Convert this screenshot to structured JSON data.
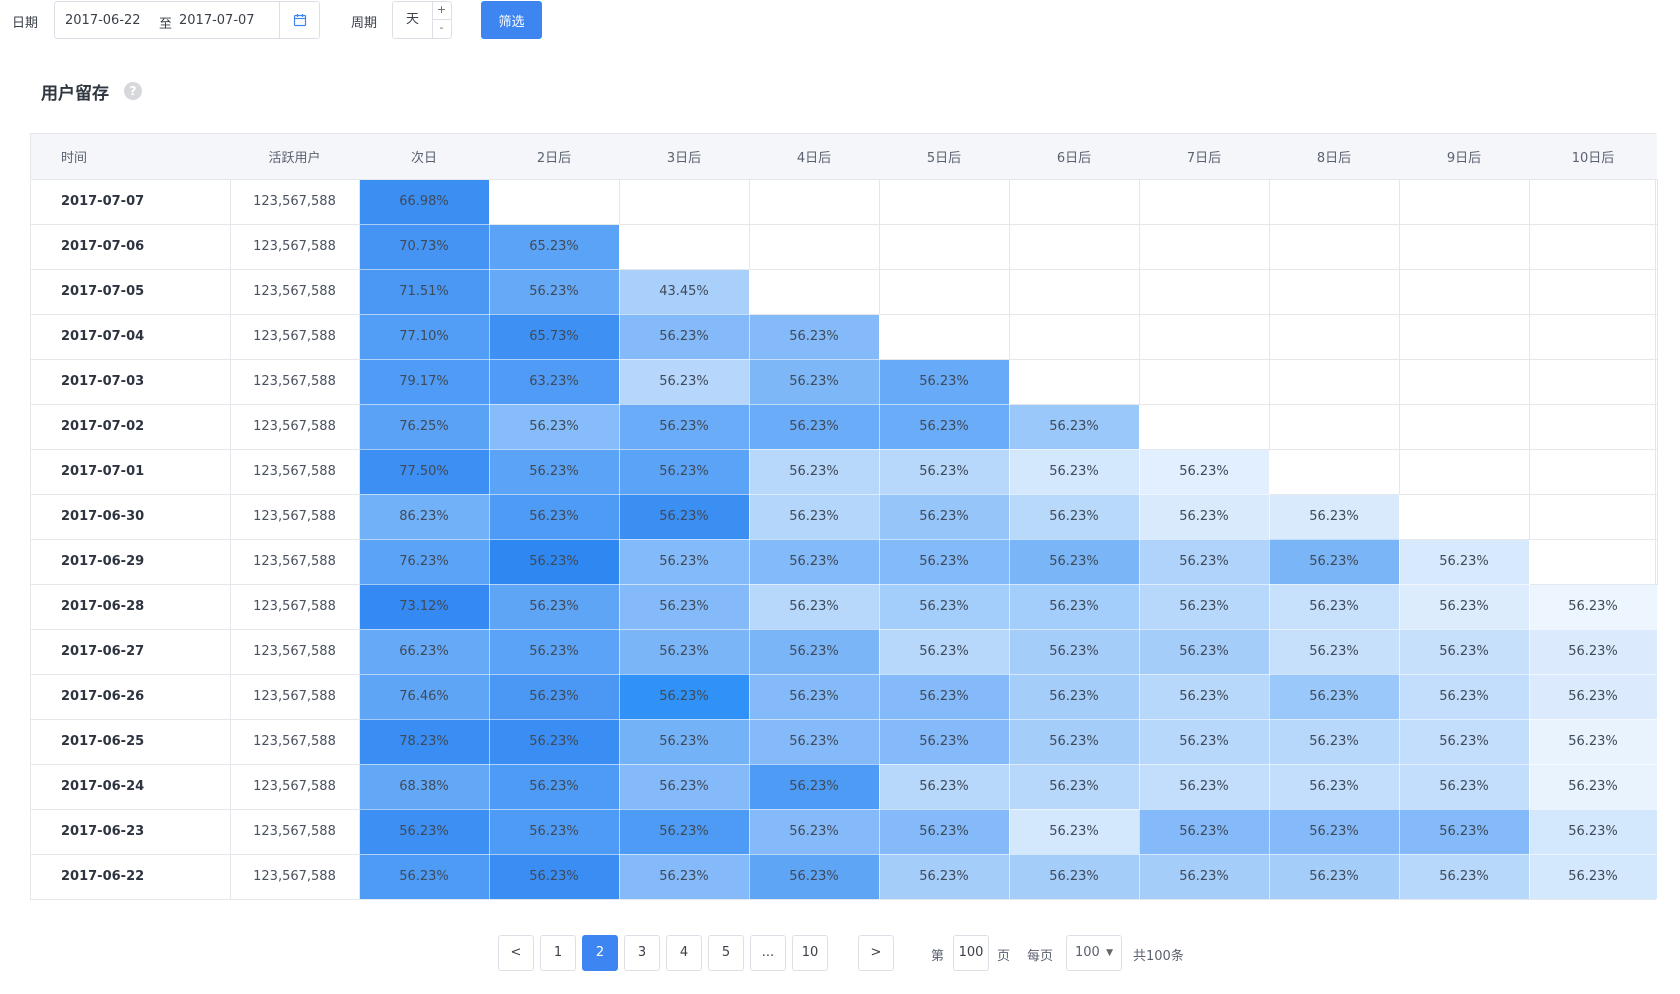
{
  "filter": {
    "date_label": "日期",
    "start_date": "2017-06-22",
    "range_sep": "至",
    "end_date": "2017-07-07",
    "calendar_icon": "calendar-icon",
    "period_label": "周期",
    "period_value": "天",
    "increment": "+",
    "decrement": "-",
    "submit_label": "筛选",
    "accent_color": "#3d85f1"
  },
  "section": {
    "title": "用户留存",
    "help_glyph": "?"
  },
  "table": {
    "headers": [
      "时间",
      "活跃用户",
      "次日",
      "2日后",
      "3日后",
      "4日后",
      "5日后",
      "6日后",
      "7日后",
      "8日后",
      "9日后",
      "10日后"
    ],
    "rows": [
      {
        "date": "2017-07-07",
        "users": "123,567,588",
        "cells": [
          "66.98%"
        ]
      },
      {
        "date": "2017-07-06",
        "users": "123,567,588",
        "cells": [
          "70.73%",
          "65.23%"
        ]
      },
      {
        "date": "2017-07-05",
        "users": "123,567,588",
        "cells": [
          "71.51%",
          "56.23%",
          "43.45%"
        ]
      },
      {
        "date": "2017-07-04",
        "users": "123,567,588",
        "cells": [
          "77.10%",
          "65.73%",
          "56.23%",
          "56.23%"
        ]
      },
      {
        "date": "2017-07-03",
        "users": "123,567,588",
        "cells": [
          "79.17%",
          "63.23%",
          "56.23%",
          "56.23%",
          "56.23%"
        ]
      },
      {
        "date": "2017-07-02",
        "users": "123,567,588",
        "cells": [
          "76.25%",
          "56.23%",
          "56.23%",
          "56.23%",
          "56.23%",
          "56.23%"
        ]
      },
      {
        "date": "2017-07-01",
        "users": "123,567,588",
        "cells": [
          "77.50%",
          "56.23%",
          "56.23%",
          "56.23%",
          "56.23%",
          "56.23%",
          "56.23%"
        ]
      },
      {
        "date": "2017-06-30",
        "users": "123,567,588",
        "cells": [
          "86.23%",
          "56.23%",
          "56.23%",
          "56.23%",
          "56.23%",
          "56.23%",
          "56.23%",
          "56.23%"
        ]
      },
      {
        "date": "2017-06-29",
        "users": "123,567,588",
        "cells": [
          "76.23%",
          "56.23%",
          "56.23%",
          "56.23%",
          "56.23%",
          "56.23%",
          "56.23%",
          "56.23%",
          "56.23%"
        ]
      },
      {
        "date": "2017-06-28",
        "users": "123,567,588",
        "cells": [
          "73.12%",
          "56.23%",
          "56.23%",
          "56.23%",
          "56.23%",
          "56.23%",
          "56.23%",
          "56.23%",
          "56.23%",
          "56.23%"
        ]
      },
      {
        "date": "2017-06-27",
        "users": "123,567,588",
        "cells": [
          "66.23%",
          "56.23%",
          "56.23%",
          "56.23%",
          "56.23%",
          "56.23%",
          "56.23%",
          "56.23%",
          "56.23%",
          "56.23%"
        ]
      },
      {
        "date": "2017-06-26",
        "users": "123,567,588",
        "cells": [
          "76.46%",
          "56.23%",
          "56.23%",
          "56.23%",
          "56.23%",
          "56.23%",
          "56.23%",
          "56.23%",
          "56.23%",
          "56.23%"
        ]
      },
      {
        "date": "2017-06-25",
        "users": "123,567,588",
        "cells": [
          "78.23%",
          "56.23%",
          "56.23%",
          "56.23%",
          "56.23%",
          "56.23%",
          "56.23%",
          "56.23%",
          "56.23%",
          "56.23%"
        ]
      },
      {
        "date": "2017-06-24",
        "users": "123,567,588",
        "cells": [
          "68.38%",
          "56.23%",
          "56.23%",
          "56.23%",
          "56.23%",
          "56.23%",
          "56.23%",
          "56.23%",
          "56.23%",
          "56.23%"
        ]
      },
      {
        "date": "2017-06-23",
        "users": "123,567,588",
        "cells": [
          "56.23%",
          "56.23%",
          "56.23%",
          "56.23%",
          "56.23%",
          "56.23%",
          "56.23%",
          "56.23%",
          "56.23%",
          "56.23%"
        ]
      },
      {
        "date": "2017-06-22",
        "users": "123,567,588",
        "cells": [
          "56.23%",
          "56.23%",
          "56.23%",
          "56.23%",
          "56.23%",
          "56.23%",
          "56.23%",
          "56.23%",
          "56.23%",
          "56.23%"
        ]
      }
    ],
    "heat_colors": [
      [
        "#3b8ef2"
      ],
      [
        "#4594f3",
        "#5aa3f6"
      ],
      [
        "#4a98f4",
        "#66a9f7",
        "#a9cffb"
      ],
      [
        "#529df5",
        "#3e91f3",
        "#84baf9",
        "#84baf9"
      ],
      [
        "#4f9bf5",
        "#4f9bf5",
        "#b6d7fb",
        "#7db7f8",
        "#67aaf7"
      ],
      [
        "#5aa2f6",
        "#86bcf9",
        "#6aacf7",
        "#6aacf7",
        "#6aacf7",
        "#9ac8fa"
      ],
      [
        "#3d8ff3",
        "#5ba3f6",
        "#5ba3f6",
        "#b8d8fb",
        "#b8d8fb",
        "#d3e7fd",
        "#e1effe"
      ],
      [
        "#71b1f8",
        "#4e9bf5",
        "#3b8ef2",
        "#b5d6fb",
        "#96c5fa",
        "#b9d9fb",
        "#d9eafd",
        "#d9eafd"
      ],
      [
        "#5ba3f6",
        "#2f88f2",
        "#83baf9",
        "#83baf9",
        "#83baf9",
        "#7ab5f8",
        "#b0d3fb",
        "#7ab5f8",
        "#d7e9fd"
      ],
      [
        "#3589f2",
        "#5ea5f6",
        "#84baf9",
        "#b7d7fb",
        "#a3cdfa",
        "#a3cdfa",
        "#b7d7fb",
        "#c7e0fc",
        "#dcecfd",
        "#edf5fe"
      ],
      [
        "#66aaf7",
        "#5ba3f6",
        "#7ab5f8",
        "#7ab5f8",
        "#b7d7fb",
        "#a4cdfa",
        "#a4cdfa",
        "#c6e0fc",
        "#c6e0fc",
        "#dbebfd"
      ],
      [
        "#5ea5f6",
        "#4a98f4",
        "#3092f6",
        "#84baf9",
        "#84baf9",
        "#a4cdfa",
        "#b7d7fb",
        "#9ac8fa",
        "#c3defc",
        "#dbebfd"
      ],
      [
        "#3a8df3",
        "#3a8df3",
        "#74b2f8",
        "#84baf9",
        "#84baf9",
        "#a4cdfa",
        "#b7d7fb",
        "#b7d7fb",
        "#c3defc",
        "#e9f3fe"
      ],
      [
        "#63a8f7",
        "#4e9bf5",
        "#84baf9",
        "#4e9bf5",
        "#b7d7fb",
        "#b7d7fb",
        "#c3defc",
        "#c3defc",
        "#c3defc",
        "#e9f3fe"
      ],
      [
        "#3d8ff3",
        "#4e9bf5",
        "#4e9bf5",
        "#84baf9",
        "#84baf9",
        "#d3e7fd",
        "#84baf9",
        "#84baf9",
        "#84baf9",
        "#d3e7fd"
      ],
      [
        "#4e9bf5",
        "#3a8df3",
        "#84baf9",
        "#5ea5f6",
        "#a4cdfa",
        "#a4cdfa",
        "#a4cdfa",
        "#a4cdfa",
        "#b7d7fb",
        "#d3e7fd"
      ]
    ]
  },
  "pagination": {
    "prev": "<",
    "next": ">",
    "pages": [
      "1",
      "2",
      "3",
      "4",
      "5",
      "...",
      "10"
    ],
    "current": "2",
    "jump_prefix": "第",
    "jump_value": "100",
    "jump_suffix": "页",
    "per_page_label": "每页",
    "per_page_value": "100",
    "total": "共100条"
  }
}
